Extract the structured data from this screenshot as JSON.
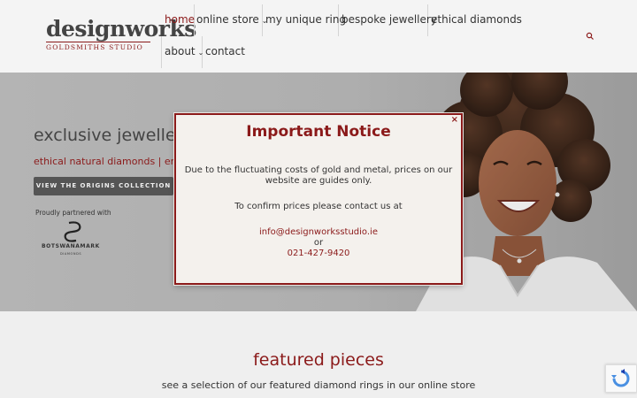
{
  "header": {
    "logo": {
      "main": "designworks",
      "sub": "GOLDSMITHS STUDIO"
    },
    "nav": [
      {
        "label": "home",
        "active": true
      },
      {
        "label": "online store",
        "dropdown": true
      },
      {
        "label": "my unique ring"
      },
      {
        "label": "bespoke jewellery"
      },
      {
        "label": "ethical diamonds"
      },
      {
        "label": "about",
        "dropdown": true
      },
      {
        "label": "contact"
      }
    ],
    "search_icon": "search-icon"
  },
  "hero": {
    "title": "exclusive jewellery",
    "subtitle": "ethical natural diamonds | engagement rings",
    "button_label": "VIEW THE ORIGINS COLLECTION",
    "partner_label": "Proudly partnered with",
    "partner_name": "BOTSWANAMARK",
    "partner_sub": "DIAMONDS"
  },
  "featured": {
    "title": "featured pieces",
    "subtitle": "see a selection of our featured diamond rings in our online store"
  },
  "modal": {
    "close_label": "×",
    "title": "Important Notice",
    "line1": "Due to the fluctuating costs of gold and metal, prices on our",
    "line2": "website are guides only.",
    "line3": "To confirm prices please contact us at",
    "email": "info@designworksstudio.ie",
    "or": "or",
    "phone": "021-427-9420"
  },
  "colors": {
    "accent": "#8b1a1a",
    "header_bg": "#f4f4f4",
    "page_bg": "#efefef",
    "modal_bg": "#f4f1ed"
  }
}
